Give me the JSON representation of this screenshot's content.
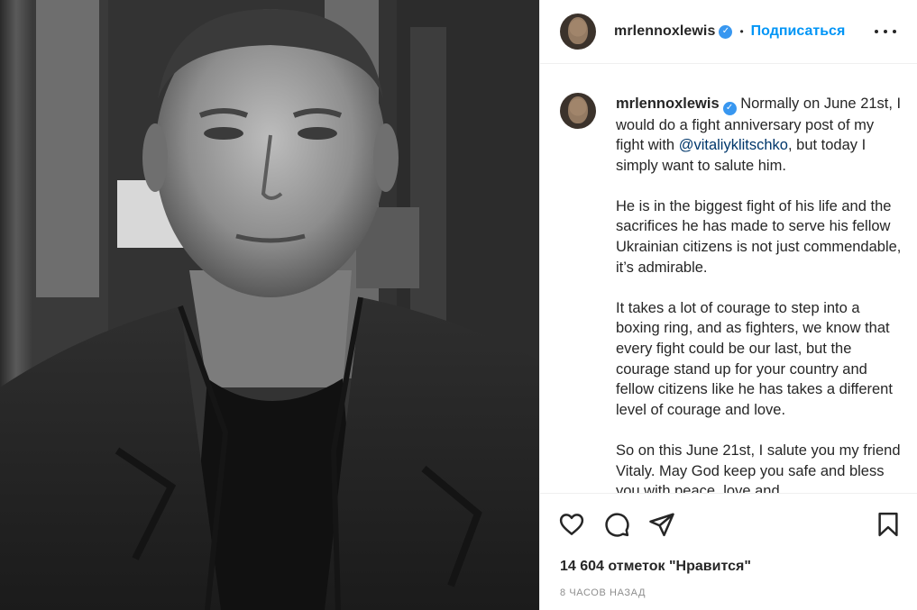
{
  "post": {
    "photo": {
      "description_icon": "portrait-photo"
    },
    "header": {
      "username": "mrlennoxlewis",
      "verified_icon": "verified-badge-icon",
      "separator": "•",
      "follow_label": "Подписаться",
      "more_icon": "more-options-icon"
    },
    "caption": {
      "username": "mrlennoxlewis",
      "intro": "Normally on June 21st, I would do a fight anniversary post of my fight with ",
      "mention": "@vitaliyklitschko",
      "intro_end": ", but today I simply want to salute him.",
      "paragraph_2": "He is in the biggest fight of his life and the sacrifices he has made to serve his fellow Ukrainian citizens is not just commendable, it’s admirable.",
      "paragraph_3": "It takes a lot of courage to step into a boxing ring, and as fighters, we know that every fight could be our last, but the courage stand up for your country and fellow citizens like he has takes a different level of courage and love.",
      "paragraph_4": "So on this June 21st, I salute you my friend Vitaly. May God keep you safe and bless you with peace, love and"
    },
    "actions": {
      "like_icon": "heart-icon",
      "comment_icon": "comment-icon",
      "share_icon": "send-icon",
      "save_icon": "bookmark-icon"
    },
    "likes_text": "14 604 отметок \"Нравится\"",
    "timestamp": "8 ЧАСОВ НАЗАД",
    "colors": {
      "link": "#0095f6",
      "mention": "#00376b",
      "text": "#262626",
      "muted": "#8e8e8e",
      "verified": "#3897f0"
    }
  }
}
